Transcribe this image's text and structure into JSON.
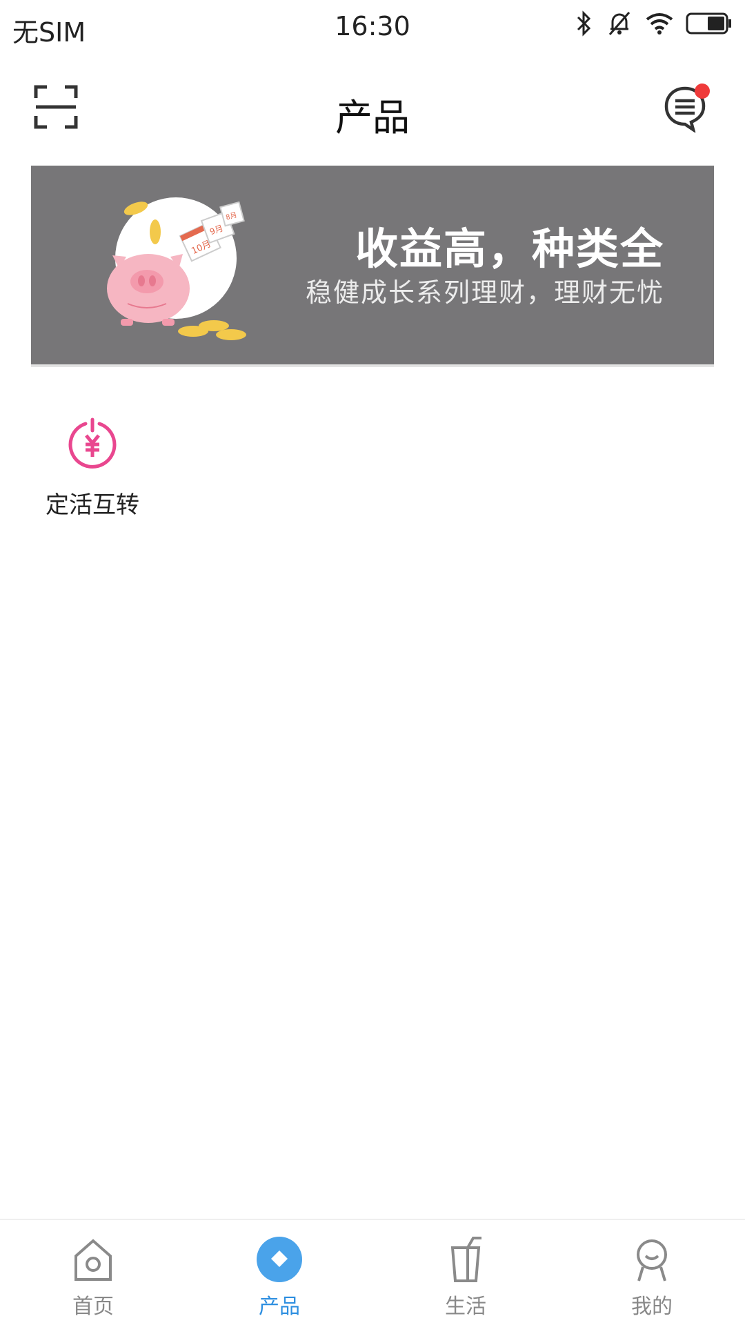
{
  "status_bar": {
    "carrier": "无SIM",
    "time": "16:30"
  },
  "header": {
    "title": "产品",
    "scan_icon": "scan-icon",
    "message_icon": "message-icon",
    "has_unread": true
  },
  "banner": {
    "title": "收益高，种类全",
    "subtitle": "稳健成长系列理财，理财无忧",
    "illustration": "piggy-bank-illustration",
    "calendar_labels": [
      "10月",
      "9月",
      "8月"
    ]
  },
  "entries": [
    {
      "label": "定活互转",
      "icon": "yuan-power-icon"
    }
  ],
  "tabs": [
    {
      "label": "首页",
      "icon": "home-icon",
      "active": false
    },
    {
      "label": "产品",
      "icon": "product-diamond-icon",
      "active": true
    },
    {
      "label": "生活",
      "icon": "cup-icon",
      "active": false
    },
    {
      "label": "我的",
      "icon": "user-icon",
      "active": false
    }
  ],
  "colors": {
    "accent": "#2e8fe0",
    "banner_bg": "#777678",
    "badge": "#ef3a3a",
    "entry_icon": "#e9478f"
  }
}
